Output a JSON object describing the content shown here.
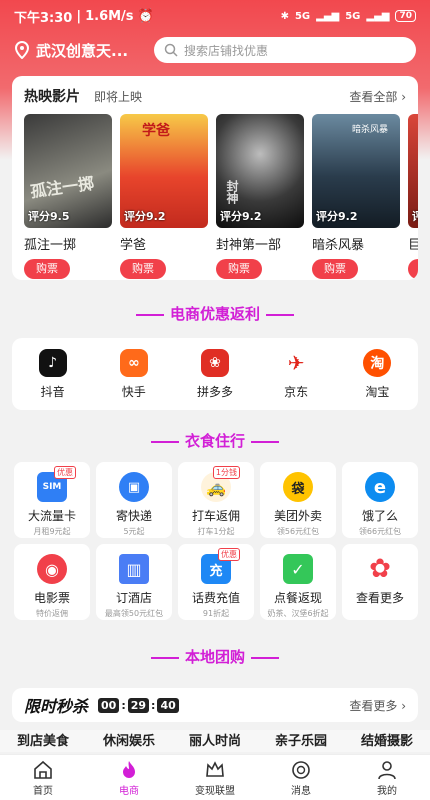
{
  "status": {
    "time": "下午3:30",
    "speed": "1.6M/s",
    "battery": "70",
    "net1": "5G",
    "net2": "5G"
  },
  "header": {
    "location": "武汉创意天...",
    "search_placeholder": "搜索店铺找优惠"
  },
  "movies": {
    "title": "热映影片",
    "upcoming": "即将上映",
    "view_all": "查看全部 ›",
    "items": [
      {
        "name": "孤注一掷",
        "rating": "评分9.5",
        "buy": "购票",
        "poster_text": "孤注一掷"
      },
      {
        "name": "学爸",
        "rating": "评分9.2",
        "buy": "购票",
        "poster_text": "学爸"
      },
      {
        "name": "封神第一部",
        "rating": "评分9.2",
        "buy": "购票",
        "poster_text": "封神"
      },
      {
        "name": "暗杀风暴",
        "rating": "评分9.2",
        "buy": "购票",
        "poster_text": "暗杀风暴"
      },
      {
        "name": "巨",
        "rating": "评",
        "buy": "购",
        "poster_text": ""
      }
    ]
  },
  "ecommerce": {
    "title": "电商优惠返利",
    "items": [
      {
        "label": "抖音",
        "glyph": "♪",
        "color": "#111111"
      },
      {
        "label": "快手",
        "glyph": "∞",
        "color": "#ff6a1a"
      },
      {
        "label": "拼多多",
        "glyph": "❀",
        "color": "#e02e24"
      },
      {
        "label": "京东",
        "glyph": "✈",
        "color": "#e1251b"
      },
      {
        "label": "淘宝",
        "glyph": "淘",
        "color": "#ff5000"
      }
    ]
  },
  "life": {
    "title": "衣食住行",
    "items": [
      {
        "label": "大流量卡",
        "sub": "月租9元起",
        "tag": "优惠",
        "glyph": "SIM",
        "color": "#2f7ff5"
      },
      {
        "label": "寄快递",
        "sub": "5元起",
        "tag": "",
        "glyph": "▣",
        "color": "#2f7ff5"
      },
      {
        "label": "打车返佣",
        "sub": "打车1分起",
        "tag": "1分钱",
        "glyph": "🚕",
        "color": "#f5a623"
      },
      {
        "label": "美团外卖",
        "sub": "领56元红包",
        "tag": "",
        "glyph": "袋",
        "color": "#ffc300"
      },
      {
        "label": "饿了么",
        "sub": "领66元红包",
        "tag": "",
        "glyph": "e",
        "color": "#0d8cf0"
      },
      {
        "label": "电影票",
        "sub": "特价返佣",
        "tag": "",
        "glyph": "◉",
        "color": "#f1404a"
      },
      {
        "label": "订酒店",
        "sub": "最高领50元红包",
        "tag": "",
        "glyph": "▥",
        "color": "#4a7df5"
      },
      {
        "label": "话费充值",
        "sub": "91折起",
        "tag": "优惠",
        "glyph": "充",
        "color": "#1e88f5"
      },
      {
        "label": "点餐返现",
        "sub": "奶茶、汉堡6折起",
        "tag": "",
        "glyph": "✓",
        "color": "#34c759"
      },
      {
        "label": "查看更多",
        "sub": "",
        "tag": "",
        "glyph": "✿",
        "color": "#f1404a"
      }
    ]
  },
  "local": {
    "title": "本地团购"
  },
  "flash_sale": {
    "title": "限时秒杀",
    "h": "00",
    "m": "29",
    "s": "40",
    "more": "查看更多 ›"
  },
  "categories": [
    "到店美食",
    "休闲娱乐",
    "丽人时尚",
    "亲子乐园",
    "结婚摄影"
  ],
  "tabs": [
    {
      "label": "首页"
    },
    {
      "label": "电商"
    },
    {
      "label": "变现联盟"
    },
    {
      "label": "消息"
    },
    {
      "label": "我的"
    }
  ],
  "colors": {
    "accent": "#f1404a",
    "section": "#d21fd6"
  }
}
